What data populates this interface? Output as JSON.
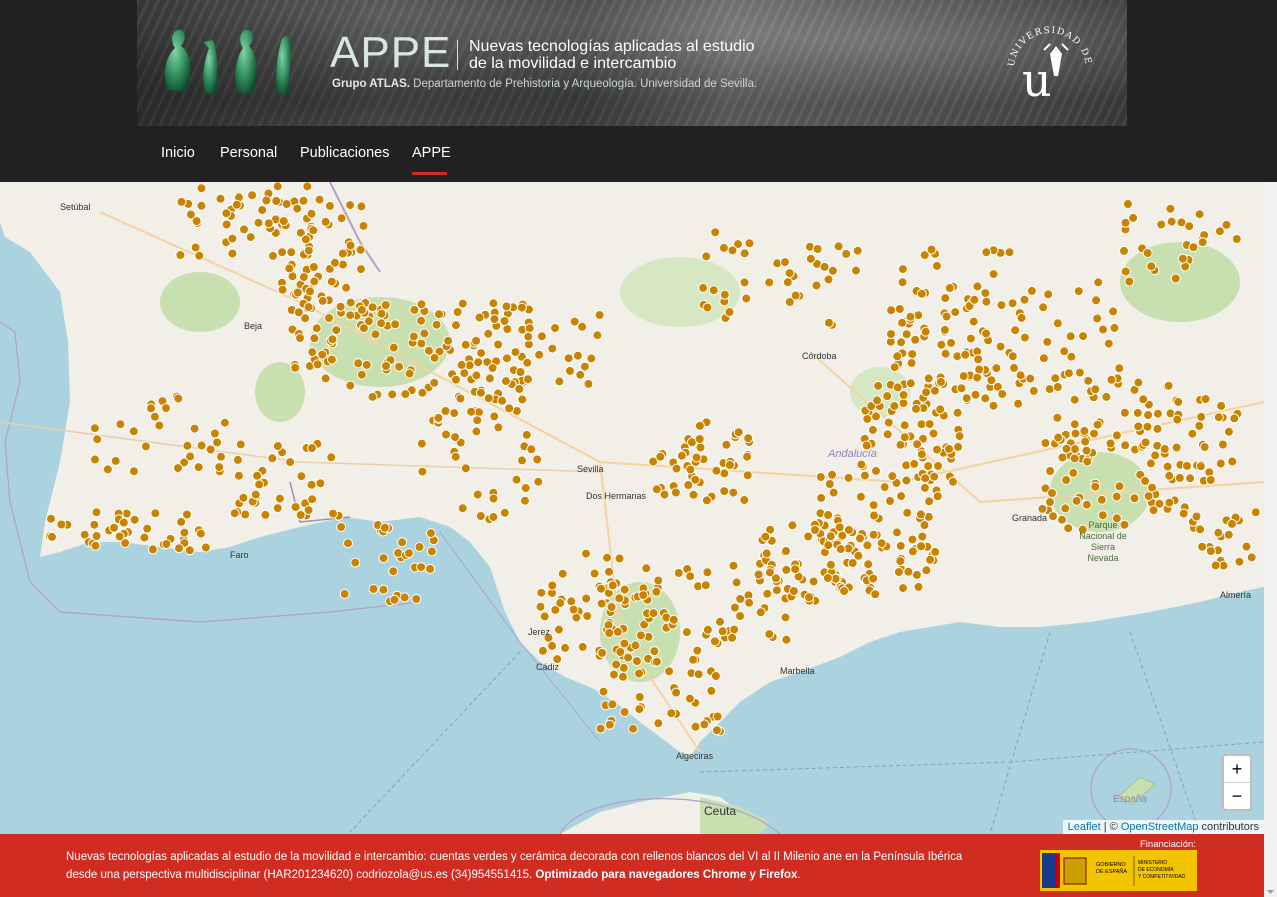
{
  "header": {
    "site_name": "APPE",
    "title_line1": "Nuevas tecnologías aplicadas al estudio",
    "title_line2": "de la movilidad e intercambio",
    "group_name": "Grupo ATLAS.",
    "group_detail": "Departamento de Prehistoria y Arqueología. Universidad de Sevilla.",
    "university_seal_text": "UNIVERSIDAD DE SEVILLA"
  },
  "nav": {
    "items": [
      {
        "label": "Inicio"
      },
      {
        "label": "Personal"
      },
      {
        "label": "Publicaciones"
      },
      {
        "label": "APPE"
      }
    ],
    "active_index": 3,
    "active_color": "#d02c22"
  },
  "map": {
    "zoom_in": "+",
    "zoom_out": "−",
    "attribution_leaflet": "Leaflet",
    "attribution_sep": " | © ",
    "attribution_osm": "OpenStreetMap",
    "attribution_contrib": " contributors",
    "marker_color": "#c88400",
    "sea_color": "#aad3df",
    "labels": {
      "beja": "Beja",
      "cordoba": "Córdoba",
      "andalucia": "Andalucía",
      "sevilla": "Sevilla",
      "dos_hermanas": "Dos Hermanas",
      "faro": "Faro",
      "granada": "Granada",
      "parque": "Parque Nacional de Sierra Nevada",
      "almeria": "Almería",
      "cadiz": "Cádiz",
      "jerez": "Jerez",
      "marbella": "Marbella",
      "algeciras": "Algeciras",
      "ceuta": "Ceuta",
      "espana": "España",
      "setubal": "Setúbal"
    }
  },
  "footer": {
    "text_line1": "Nuevas tecnologías aplicadas al estudio de la movilidad e intercambio: cuentas verdes y cerámica decorada con rellenos blancos del VI al II Milenio ane en la Península Ibérica",
    "text_line2": "desde una perspectiva multidisciplinar (HAR201234620) codriozola@us.es (34)954551415.",
    "text_bold": "Optimizado para navegadores Chrome y Firefox",
    "text_end": ".",
    "financiacion": "Financiación:",
    "gov_line1": "GOBIERNO",
    "gov_line2": "DE ESPAÑA",
    "min_line1": "MINISTERIO",
    "min_line2": "DE ECONOMÍA",
    "min_line3": "Y COMPETITIVIDAD"
  }
}
